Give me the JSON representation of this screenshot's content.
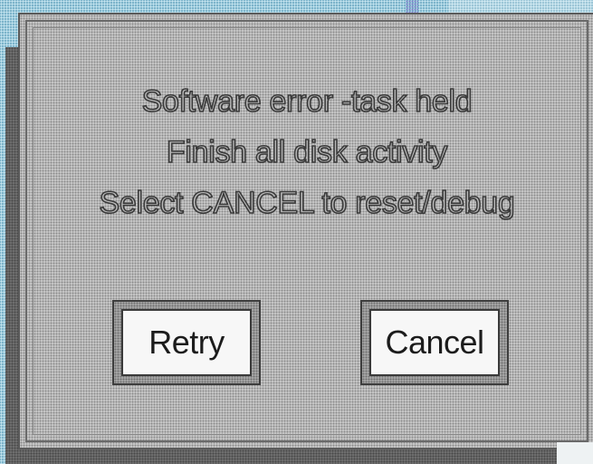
{
  "dialog": {
    "message_lines": [
      "Software error -task held",
      "Finish all disk activity",
      "Select CANCEL to reset/debug"
    ],
    "buttons": {
      "retry_label": "Retry",
      "cancel_label": "Cancel"
    }
  },
  "colors": {
    "background": "#8fc8dc",
    "dialog_fill": "#c9c9c9",
    "button_fill": "#f7f7f7",
    "shadow": "#6e6e6e"
  }
}
